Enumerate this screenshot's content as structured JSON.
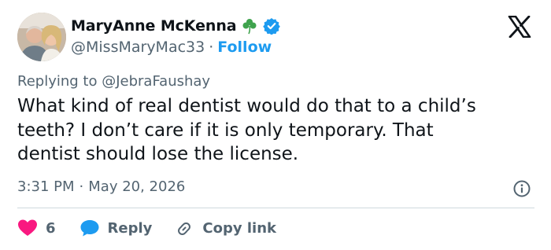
{
  "user": {
    "display_name": "MaryAnne McKenna",
    "handle": "@MissMaryMac33",
    "separator": "·",
    "follow_label": "Follow",
    "avatar_icon": "profile-photo",
    "emoji_icon": "shamrock-icon",
    "verified_icon": "verified-badge-icon"
  },
  "platform_icon": "x-logo-icon",
  "reply": {
    "prefix": "Replying to",
    "mention": "@JebraFaushay"
  },
  "tweet": {
    "lines": [
      "What kind of real dentist would do that to a child’s",
      "teeth? I don’t care if it is only temporary. That",
      "dentist should lose the license."
    ]
  },
  "meta": {
    "time": "3:31 PM",
    "separator": "·",
    "date": "May 20, 2026"
  },
  "actions": {
    "like_count": "6",
    "reply_label": "Reply",
    "copy_label": "Copy link"
  },
  "colors": {
    "accent": "#1d9bf0",
    "text": "#0f1419",
    "muted": "#536471",
    "like": "#f91880",
    "shamrock": "#3fa34d"
  }
}
